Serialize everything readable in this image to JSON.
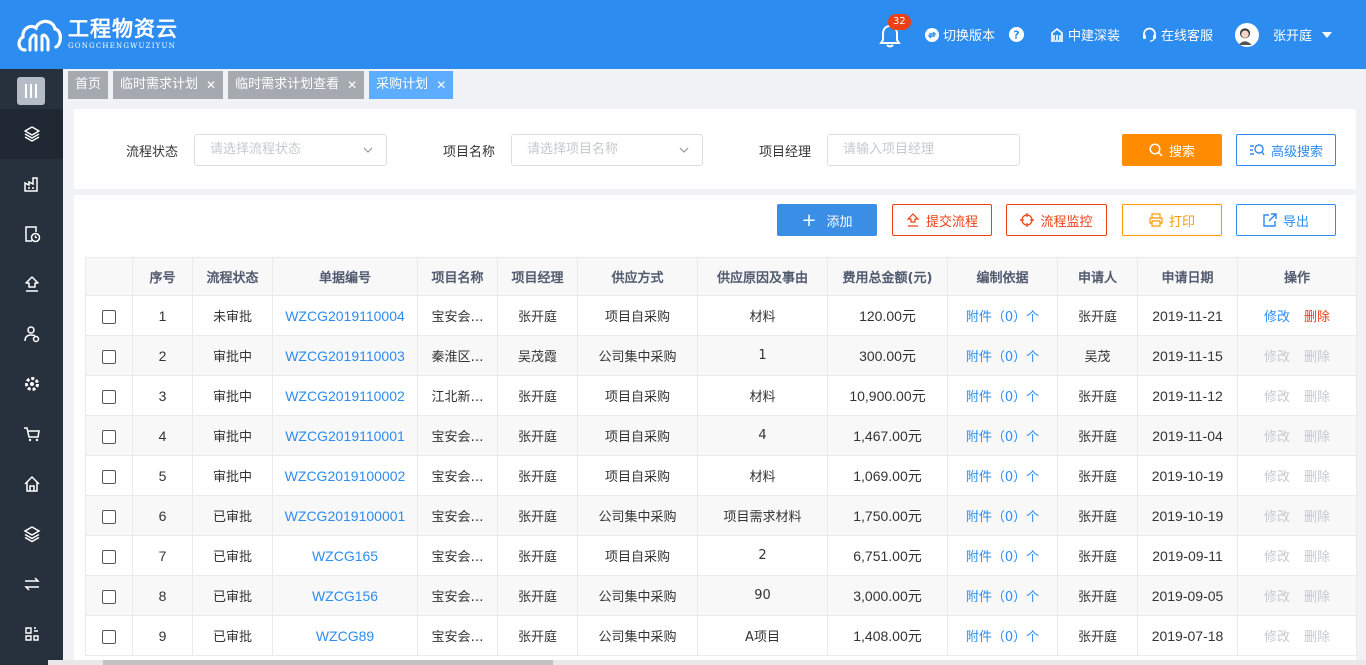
{
  "header": {
    "logo_title": "工程物资云",
    "logo_sub": "GONGCHENGWUZIYUN",
    "notification_count": "32",
    "switch_version": "切换版本",
    "company": "中建深装",
    "service": "在线客服",
    "user": "张开庭",
    "colors": {
      "primary": "#2d8cf0"
    }
  },
  "sidebar": {
    "icons": [
      "menu-toggle-icon",
      "layers-icon",
      "factory-icon",
      "clock-document-icon",
      "upload-icon",
      "user-settings-icon",
      "gear-icon",
      "cart-icon",
      "home-icon",
      "stack-icon",
      "transfer-icon",
      "grid-icon"
    ]
  },
  "tabs": [
    {
      "label": "首页",
      "closable": false,
      "active": false
    },
    {
      "label": "临时需求计划",
      "closable": true,
      "active": false
    },
    {
      "label": "临时需求计划查看",
      "closable": true,
      "active": false
    },
    {
      "label": "采购计划",
      "closable": true,
      "active": true
    }
  ],
  "search": {
    "status_label": "流程状态",
    "status_placeholder": "请选择流程状态",
    "project_label": "项目名称",
    "project_placeholder": "请选择项目名称",
    "manager_label": "项目经理",
    "manager_placeholder": "请输入项目经理",
    "search_btn": "搜索",
    "advanced_btn": "高级搜索"
  },
  "toolbar": {
    "add": "添加",
    "submit": "提交流程",
    "monitor": "流程监控",
    "print": "打印",
    "export": "导出"
  },
  "table": {
    "headers": [
      "序号",
      "流程状态",
      "单据编号",
      "项目名称",
      "项目经理",
      "供应方式",
      "供应原因及事由",
      "费用总金额(元)",
      "编制依据",
      "申请人",
      "申请日期",
      "操作"
    ],
    "attach_label": "附件（0）个",
    "edit_label": "修改",
    "delete_label": "删除",
    "rows": [
      {
        "no": "1",
        "status": "未审批",
        "code": "WZCG2019110004",
        "project": "宝安会…",
        "manager": "张开庭",
        "supply": "项目自采购",
        "reason": "材料",
        "amount": "120.00元",
        "applicant": "张开庭",
        "date": "2019-11-21",
        "enabled": true
      },
      {
        "no": "2",
        "status": "审批中",
        "code": "WZCG2019110003",
        "project": "秦淮区…",
        "manager": "吴茂霞",
        "supply": "公司集中采购",
        "reason": "1",
        "amount": "300.00元",
        "applicant": "吴茂",
        "date": "2019-11-15",
        "enabled": false
      },
      {
        "no": "3",
        "status": "审批中",
        "code": "WZCG2019110002",
        "project": "江北新…",
        "manager": "张开庭",
        "supply": "项目自采购",
        "reason": "材料",
        "amount": "10,900.00元",
        "applicant": "张开庭",
        "date": "2019-11-12",
        "enabled": false
      },
      {
        "no": "4",
        "status": "审批中",
        "code": "WZCG2019110001",
        "project": "宝安会…",
        "manager": "张开庭",
        "supply": "项目自采购",
        "reason": "4",
        "amount": "1,467.00元",
        "applicant": "张开庭",
        "date": "2019-11-04",
        "enabled": false
      },
      {
        "no": "5",
        "status": "审批中",
        "code": "WZCG2019100002",
        "project": "宝安会…",
        "manager": "张开庭",
        "supply": "项目自采购",
        "reason": "材料",
        "amount": "1,069.00元",
        "applicant": "张开庭",
        "date": "2019-10-19",
        "enabled": false
      },
      {
        "no": "6",
        "status": "已审批",
        "code": "WZCG2019100001",
        "project": "宝安会…",
        "manager": "张开庭",
        "supply": "公司集中采购",
        "reason": "项目需求材料",
        "amount": "1,750.00元",
        "applicant": "张开庭",
        "date": "2019-10-19",
        "enabled": false
      },
      {
        "no": "7",
        "status": "已审批",
        "code": "WZCG165",
        "project": "宝安会…",
        "manager": "张开庭",
        "supply": "项目自采购",
        "reason": "2",
        "amount": "6,751.00元",
        "applicant": "张开庭",
        "date": "2019-09-11",
        "enabled": false
      },
      {
        "no": "8",
        "status": "已审批",
        "code": "WZCG156",
        "project": "宝安会…",
        "manager": "张开庭",
        "supply": "公司集中采购",
        "reason": "90",
        "amount": "3,000.00元",
        "applicant": "张开庭",
        "date": "2019-09-05",
        "enabled": false
      },
      {
        "no": "9",
        "status": "已审批",
        "code": "WZCG89",
        "project": "宝安会…",
        "manager": "张开庭",
        "supply": "公司集中采购",
        "reason": "A项目",
        "amount": "1,408.00元",
        "applicant": "张开庭",
        "date": "2019-07-18",
        "enabled": false
      }
    ]
  }
}
